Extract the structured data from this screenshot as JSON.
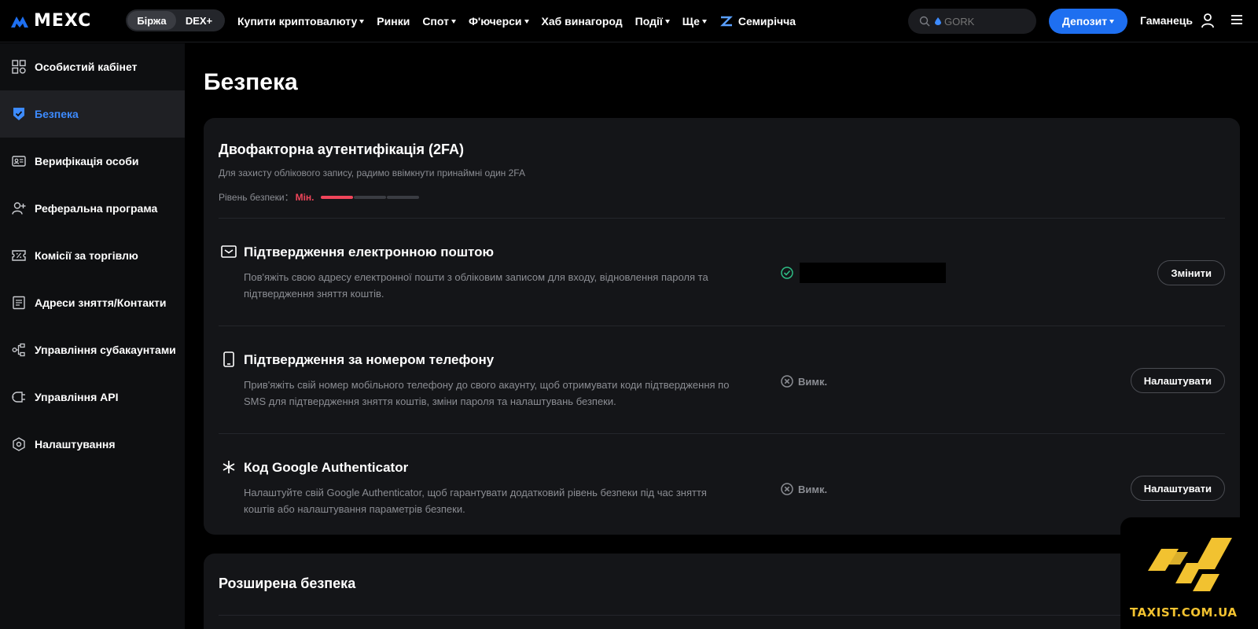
{
  "header": {
    "brand": "MEXC",
    "segment": [
      "Біржа",
      "DEX+"
    ],
    "nav": [
      {
        "label": "Купити криптовалюту",
        "caret": true
      },
      {
        "label": "Ринки",
        "caret": false
      },
      {
        "label": "Спот",
        "caret": true
      },
      {
        "label": "Ф'ючерси",
        "caret": true
      },
      {
        "label": "Хаб винагород",
        "caret": false
      },
      {
        "label": "Події",
        "caret": true
      },
      {
        "label": "Ще",
        "caret": true
      },
      {
        "label": "Семирічча",
        "caret": false,
        "icon": "zigzag-icon"
      }
    ],
    "search_placeholder": "GORK",
    "deposit_label": "Депозит",
    "wallet_label": "Гаманець"
  },
  "sidebar": {
    "items": [
      {
        "label": "Особистий кабінет",
        "icon": "dashboard-icon",
        "active": false
      },
      {
        "label": "Безпека",
        "icon": "shield-icon",
        "active": true
      },
      {
        "label": "Верифікація особи",
        "icon": "id-card-icon",
        "active": false
      },
      {
        "label": "Реферальна програма",
        "icon": "user-plus-icon",
        "active": false
      },
      {
        "label": "Комісії за торгівлю",
        "icon": "fee-ticket-icon",
        "active": false
      },
      {
        "label": "Адреси зняття/Контакти",
        "icon": "address-book-icon",
        "active": false
      },
      {
        "label": "Управління субакаунтами",
        "icon": "subaccount-icon",
        "active": false
      },
      {
        "label": "Управління API",
        "icon": "api-plug-icon",
        "active": false
      },
      {
        "label": "Налаштування",
        "icon": "settings-hex-icon",
        "active": false
      }
    ]
  },
  "main": {
    "title": "Безпека",
    "twofa": {
      "title": "Двофакторна аутентифікація (2FA)",
      "subtitle": "Для захисту облікового запису, радимо ввімкнути принаймні один 2FA",
      "level_label": "Рівень безпеки",
      "level_value": "Мін.",
      "level_segments_on": 1,
      "level_segments_total": 3,
      "rows": [
        {
          "icon": "email-icon",
          "title": "Підтвердження електронною поштою",
          "description": "Пов'яжіть свою адресу електронної пошти з обліковим записом для входу, відновлення пароля та підтвердження зняття коштів.",
          "status": "",
          "status_icon": "check-circle-icon",
          "button": "Змінити"
        },
        {
          "icon": "phone-icon",
          "title": "Підтвердження за номером телефону",
          "description": "Прив'яжіть свій номер мобільного телефону до свого акаунту, щоб отримувати коди підтвердження по SMS для підтвердження зняття коштів, зміни пароля та налаштувань безпеки.",
          "status": "Вимк.",
          "status_icon": "x-circle-icon",
          "button": "Налаштувати"
        },
        {
          "icon": "asterisk-icon",
          "title": "Код Google Authenticator",
          "description": "Налаштуйте свій Google Authenticator, щоб гарантувати додатковий рівень безпеки під час зняття коштів або налаштування параметрів безпеки.",
          "status": "Вимк.",
          "status_icon": "x-circle-icon",
          "button": "Налаштувати"
        }
      ]
    },
    "advanced": {
      "title": "Розширена безпека"
    }
  },
  "watermark": {
    "text": "TAXIST.COM.UA",
    "colors": {
      "accent": "#f2c230"
    }
  },
  "colors": {
    "accent": "#1e6ff0",
    "active_nav": "#3d8bff",
    "danger": "#f0455a",
    "success": "#2ebd85"
  }
}
